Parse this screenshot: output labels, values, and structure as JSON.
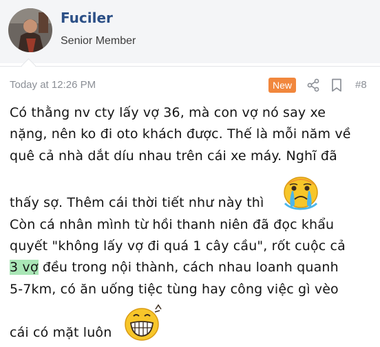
{
  "user": {
    "name": "Fuciler",
    "title": "Senior Member"
  },
  "post": {
    "time": "Today at 12:26 PM",
    "badge": "New",
    "number": "#8",
    "lines": [
      "Có thằng nv cty lấy vợ 36, mà con vợ nó say xe",
      "nặng, nên ko đi oto khách được. Thế là mỗi năm về",
      "quê cả nhà dắt díu nhau trên cái xe máy. Nghĩ đã",
      "thấy sợ. Thêm cái thời tiết như này thì",
      "Còn cá nhân mình từ hồi thanh niên đã đọc khẩu",
      "quyết \"không lấy vợ đi quá 1 cây cầu\", rốt cuộc cả",
      "đều trong nội thành, cách nhau loanh quanh",
      "5-7km, có ăn uống tiệc tùng hay công việc gì vèo",
      "cái có mặt luôn"
    ],
    "highlight": "3 vợ",
    "emojis": [
      "crying-sweat-emoji",
      "grin-emoji"
    ]
  },
  "colors": {
    "username": "#2b4f86",
    "badge": "#f1873d",
    "highlight": "#a9e6b6",
    "meta": "#8b8f96"
  }
}
